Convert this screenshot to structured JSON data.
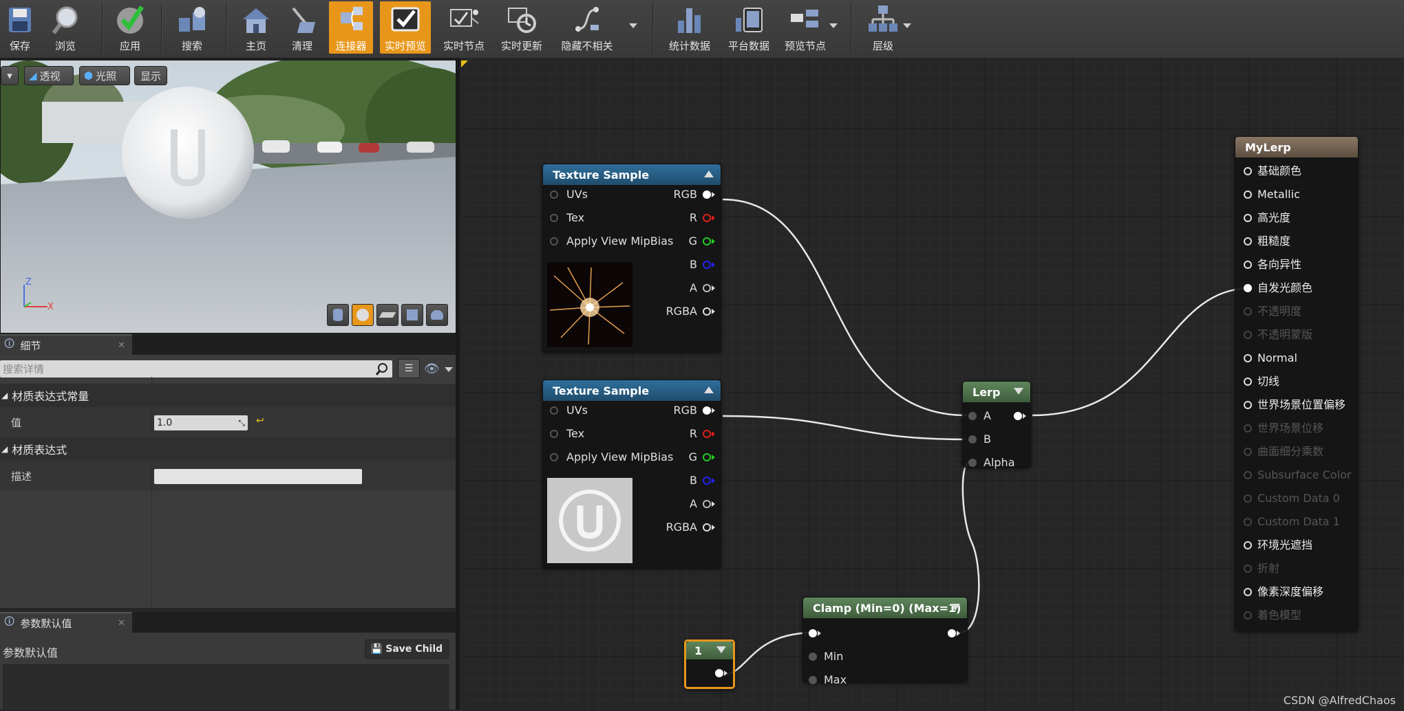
{
  "toolbar": {
    "items": [
      {
        "label": "保存",
        "icon": "save-icon"
      },
      {
        "label": "浏览",
        "icon": "browse-icon"
      },
      {
        "label": "应用",
        "icon": "apply-icon"
      },
      {
        "label": "搜索",
        "icon": "search-icon"
      },
      {
        "label": "主页",
        "icon": "home-icon"
      },
      {
        "label": "清理",
        "icon": "clean-icon"
      },
      {
        "label": "连接器",
        "icon": "connector-icon",
        "active": true
      },
      {
        "label": "实时预览",
        "icon": "live-preview-icon",
        "active": true
      },
      {
        "label": "实时节点",
        "icon": "live-nodes-icon"
      },
      {
        "label": "实时更新",
        "icon": "live-update-icon"
      },
      {
        "label": "隐藏不相关",
        "icon": "hide-unrelated-icon"
      },
      {
        "label": "统计数据",
        "icon": "stats-icon"
      },
      {
        "label": "平台数据",
        "icon": "platform-stats-icon"
      },
      {
        "label": "预览节点",
        "icon": "preview-node-icon"
      },
      {
        "label": "层级",
        "icon": "hierarchy-icon"
      }
    ]
  },
  "viewport": {
    "buttons": {
      "dropdown": "▾",
      "perspective": "透视",
      "lit": "光照",
      "show": "显示"
    },
    "axis": {
      "z": "Z",
      "x": "X"
    }
  },
  "details": {
    "tab_title": "细节",
    "search_placeholder": "搜索详情",
    "category_constant": "材质表达式常量",
    "value_label": "值",
    "value": "1.0",
    "category_expression": "材质表达式",
    "desc_label": "描述",
    "desc_value": ""
  },
  "params": {
    "tab_title": "参数默认值",
    "label": "参数默认值",
    "save_child": "Save Child"
  },
  "graph": {
    "texture1": {
      "title": "Texture Sample",
      "inputs": [
        "UVs",
        "Tex",
        "Apply View MipBias"
      ],
      "outputs": [
        "RGB",
        "R",
        "G",
        "B",
        "A",
        "RGBA"
      ]
    },
    "texture2": {
      "title": "Texture Sample",
      "inputs": [
        "UVs",
        "Tex",
        "Apply View MipBias"
      ],
      "outputs": [
        "RGB",
        "R",
        "G",
        "B",
        "A",
        "RGBA"
      ]
    },
    "lerp": {
      "title": "Lerp",
      "inputs": [
        "A",
        "B",
        "Alpha"
      ]
    },
    "clamp": {
      "title": "Clamp (Min=0) (Max=1)",
      "inputs": [
        "Min",
        "Max"
      ]
    },
    "constant": {
      "title": "1"
    },
    "result": {
      "title": "MyLerp",
      "pins": [
        {
          "label": "基础颜色",
          "enabled": true
        },
        {
          "label": "Metallic",
          "enabled": true
        },
        {
          "label": "高光度",
          "enabled": true
        },
        {
          "label": "粗糙度",
          "enabled": true
        },
        {
          "label": "各向异性",
          "enabled": true
        },
        {
          "label": "自发光颜色",
          "enabled": true,
          "connected": true
        },
        {
          "label": "不透明度",
          "enabled": false
        },
        {
          "label": "不透明蒙版",
          "enabled": false
        },
        {
          "label": "Normal",
          "enabled": true
        },
        {
          "label": "切线",
          "enabled": true
        },
        {
          "label": "世界场景位置偏移",
          "enabled": true
        },
        {
          "label": "世界场景位移",
          "enabled": false
        },
        {
          "label": "曲面细分乘数",
          "enabled": false
        },
        {
          "label": "Subsurface Color",
          "enabled": false
        },
        {
          "label": "Custom Data 0",
          "enabled": false
        },
        {
          "label": "Custom Data 1",
          "enabled": false
        },
        {
          "label": "环境光遮挡",
          "enabled": true
        },
        {
          "label": "折射",
          "enabled": false
        },
        {
          "label": "像素深度偏移",
          "enabled": true
        },
        {
          "label": "着色模型",
          "enabled": false
        }
      ]
    }
  },
  "watermark": "CSDN @AlfredChaos",
  "colors": {
    "accent": "#e8961a",
    "texture_header": "#2a5f86",
    "lerp_header": "#4c6b4a",
    "result_header": "#6e5e4e",
    "pin_r": "#e0201a",
    "pin_g": "#22cc22",
    "pin_b": "#2222ee"
  }
}
